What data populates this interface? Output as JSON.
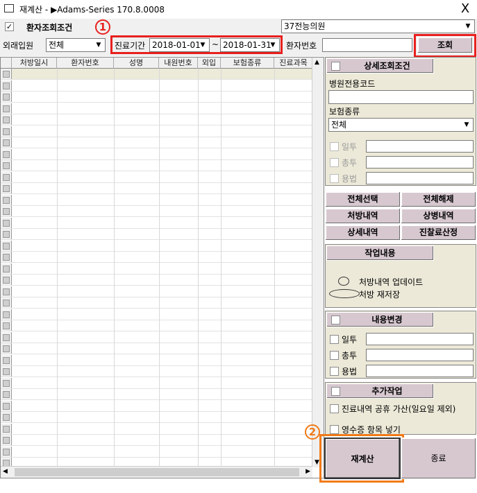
{
  "window": {
    "title": "재계산 - ▶Adams-Series 170.8.0008",
    "close_label": "X"
  },
  "top": {
    "patient_condition_checked": true,
    "patient_condition_label": "환자조회조건",
    "marker_1": "1",
    "doctor_select": "37전능의원"
  },
  "filters": {
    "visit_type_label": "외래입원",
    "visit_type_value": "전체",
    "period_label": "진료기간",
    "date_from": "2018-01-01",
    "date_sep": "~",
    "date_to": "2018-01-31",
    "patient_no_label": "환자번호",
    "patient_no_value": "",
    "search_button": "조회"
  },
  "grid": {
    "columns": [
      "처방일시",
      "환자번호",
      "성명",
      "내원번호",
      "외입",
      "보험종류",
      "진료과목"
    ]
  },
  "detail": {
    "header": "상세조회조건",
    "hospital_code_label": "병원전용코드",
    "hospital_code_value": "",
    "insurance_label": "보험종류",
    "insurance_value": "전체",
    "daily_label": "일투",
    "total_label": "총투",
    "usage_label": "용법"
  },
  "actions": {
    "select_all": "전체선택",
    "deselect_all": "전체해제",
    "prescriptions": "처방내역",
    "diseases": "상병내역",
    "details": "상세내역",
    "fee_calc": "진찰료산정"
  },
  "work": {
    "header": "작업내용",
    "option_update": "처방내역 업데이트",
    "option_resave": "처방 재저장"
  },
  "change": {
    "header": "내용변경",
    "daily_label": "일투",
    "total_label": "총투",
    "usage_label": "용법"
  },
  "extra": {
    "header": "추가작업",
    "holiday_add": "진료내역 공휴 가산(일요일 제외)",
    "receipt_items": "영수증 항목 넣기"
  },
  "bottom": {
    "marker_2": "2",
    "recalc_button": "재계산",
    "exit_button": "종료"
  },
  "colors": {
    "highlight_red": "#e8201f",
    "highlight_orange": "#f07a18",
    "button_bg": "#d7c8d0",
    "panel_bg": "#ece9d8"
  }
}
